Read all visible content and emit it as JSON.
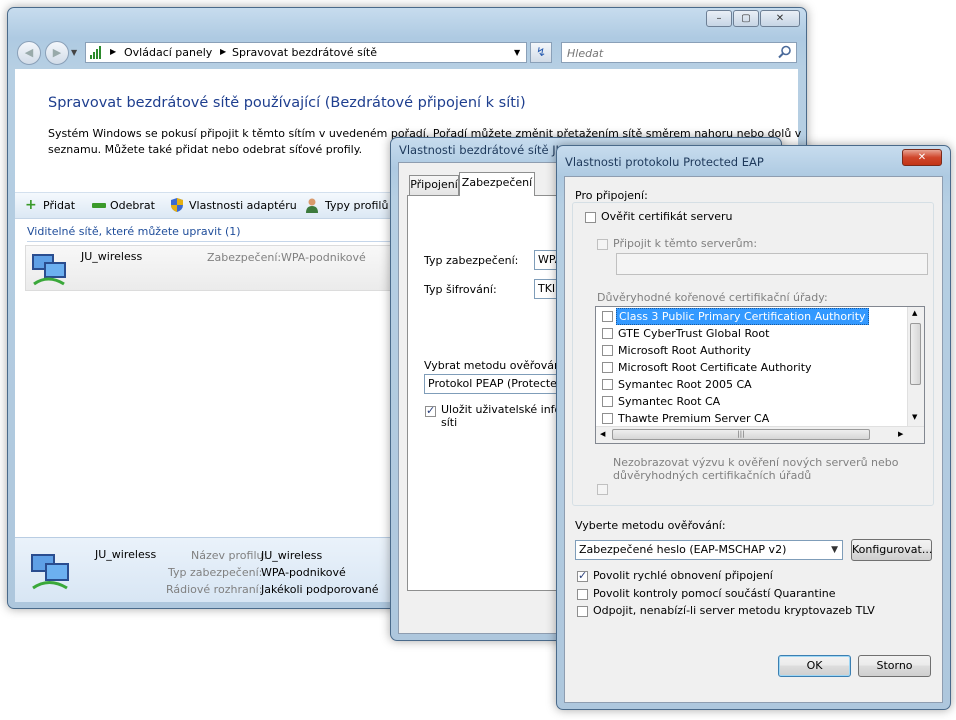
{
  "main": {
    "breadcrumb": [
      "Ovládací panely",
      "Spravovat bezdrátové sítě"
    ],
    "search_placeholder": "Hledat",
    "heading": "Spravovat bezdrátové sítě používající (Bezdrátové připojení k síti)",
    "description_line1": "Systém Windows se pokusí připojit k těmto sítím v uvedeném pořadí. Pořadí můžete změnit přetažením sítě směrem nahoru nebo dolů v",
    "description_line2": "seznamu. Můžete také přidat nebo odebrat síťové profily.",
    "toolbar": {
      "add": "Přidat",
      "remove": "Odebrat",
      "adapter": "Vlastnosti adaptéru",
      "profiles": "Typy profilů"
    },
    "visible_networks_label": "Viditelné sítě, které můžete upravit (1)",
    "network": {
      "name": "JU_wireless",
      "security_label": "Zabezpečení:",
      "security_value": "WPA-podnikové"
    },
    "details": {
      "name": "JU_wireless",
      "profile_label": "Název profilu:",
      "profile_value": "JU_wireless",
      "security_label": "Typ zabezpečení:",
      "security_value": "WPA-podnikové",
      "radio_label": "Rádiové rozhraní:",
      "radio_value": "Jakékoli podporované"
    }
  },
  "wireless_props": {
    "title": "Vlastnosti bezdrátové sítě JU_w",
    "tabs": [
      "Připojení",
      "Zabezpečení"
    ],
    "security_type_label": "Typ zabezpečení:",
    "security_type_value": "WPA",
    "encryption_label": "Typ šifrování:",
    "encryption_value": "TKIP",
    "method_label": "Vybrat metodu ověřování sí",
    "method_value": "Protokol PEAP (Protected E",
    "save_line1": "Uložit uživatelské informa",
    "save_line2": "síti"
  },
  "peap": {
    "title": "Vlastnosti protokolu Protected EAP",
    "for_connection": "Pro připojení:",
    "verify_cert": "Ověřit certifikát serveru",
    "connect_servers": "Připojit k těmto serverům:",
    "trusted_ca": "Důvěryhodné kořenové certifikační úřady:",
    "ca_list": [
      "Class 3 Public Primary Certification Authority",
      "GTE CyberTrust Global Root",
      "Microsoft Root Authority",
      "Microsoft Root Certificate Authority",
      "Symantec Root 2005 CA",
      "Symantec Root CA",
      "Thawte Premium Server CA"
    ],
    "no_prompt_line1": "Nezobrazovat výzvu k ověření nových serverů nebo",
    "no_prompt_line2": "důvěryhodných certifikačních úřadů",
    "auth_method_label": "Vyberte metodu ověřování:",
    "auth_method_value": "Zabezpečené heslo (EAP-MSCHAP v2)",
    "configure": "Konfigurovat...",
    "fast_reconnect": "Povolit rychlé obnovení připojení",
    "quarantine": "Povolit kontroly pomocí součástí Quarantine",
    "disconnect": "Odpojit, nenabízí-li server metodu kryptovazeb TLV",
    "ok": "OK",
    "cancel": "Storno"
  }
}
